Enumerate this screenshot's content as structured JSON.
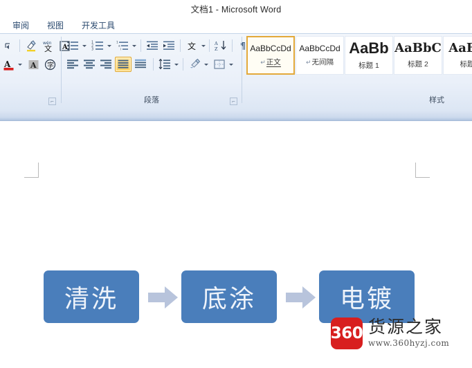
{
  "window": {
    "title": "文档1 - Microsoft Word"
  },
  "ribbon_tabs": [
    {
      "label": "审阅",
      "name": "tab-review"
    },
    {
      "label": "视图",
      "name": "tab-view"
    },
    {
      "label": "开发工具",
      "name": "tab-developer"
    }
  ],
  "ribbon": {
    "font_group": {
      "label": "",
      "buttons_row1": [
        {
          "name": "text-highlight-color-icon",
          "glyph": "✐"
        },
        {
          "name": "phonetic-guide-icon",
          "glyph": "文"
        },
        {
          "name": "character-border-icon",
          "glyph": "A"
        }
      ],
      "buttons_row2": [
        {
          "name": "font-color-icon",
          "glyph": "A"
        },
        {
          "name": "character-shading-icon",
          "glyph": "A"
        },
        {
          "name": "enclose-characters-icon",
          "glyph": "字"
        }
      ]
    },
    "paragraph_group": {
      "label": "段落",
      "buttons_row1": [
        {
          "name": "bullets-icon",
          "glyph": "≔",
          "has_caret": true
        },
        {
          "name": "numbering-icon",
          "glyph": "≕",
          "has_caret": true
        },
        {
          "name": "multilevel-list-icon",
          "glyph": "≣",
          "has_caret": true
        },
        {
          "name": "decrease-indent-icon",
          "glyph": "⇤",
          "has_caret": false
        },
        {
          "name": "increase-indent-icon",
          "glyph": "⇥",
          "has_caret": false
        },
        {
          "name": "asian-layout-icon",
          "glyph": "文",
          "has_caret": true
        },
        {
          "name": "sort-icon",
          "glyph": "A↓",
          "has_caret": false
        },
        {
          "name": "show-formatting-marks-icon",
          "glyph": "¶",
          "has_caret": false
        }
      ],
      "buttons_row2": [
        {
          "name": "align-left-icon",
          "glyph": "",
          "has_caret": false,
          "active": false
        },
        {
          "name": "align-center-icon",
          "glyph": "",
          "has_caret": false,
          "active": false
        },
        {
          "name": "align-right-icon",
          "glyph": "",
          "has_caret": false,
          "active": false
        },
        {
          "name": "justify-icon",
          "glyph": "",
          "has_caret": false,
          "active": true
        },
        {
          "name": "distributed-align-icon",
          "glyph": "",
          "has_caret": false,
          "active": false
        },
        {
          "name": "line-spacing-icon",
          "glyph": "⇕",
          "has_caret": true,
          "active": false
        },
        {
          "name": "shading-icon",
          "glyph": "◴",
          "has_caret": true,
          "active": false
        },
        {
          "name": "borders-icon",
          "glyph": "⊞",
          "has_caret": true,
          "active": false
        }
      ]
    },
    "styles_group": {
      "label": "样式",
      "items": [
        {
          "preview": "AaBbCcDd",
          "name": "正文",
          "pilcrow": "↵",
          "selected": true,
          "preview_size": "12px",
          "preview_weight": "400",
          "preview_serif": false,
          "underline": true
        },
        {
          "preview": "AaBbCcDd",
          "name": "无间隔",
          "pilcrow": "↵",
          "selected": false,
          "preview_size": "12px",
          "preview_weight": "400",
          "preview_serif": false,
          "underline": false
        },
        {
          "preview": "AaBb",
          "name": "标题 1",
          "pilcrow": "",
          "selected": false,
          "preview_size": "22px",
          "preview_weight": "700",
          "preview_serif": false,
          "underline": false
        },
        {
          "preview": "AaBbC",
          "name": "标题 2",
          "pilcrow": "",
          "selected": false,
          "preview_size": "18px",
          "preview_weight": "700",
          "preview_serif": true,
          "underline": false
        },
        {
          "preview": "AaBb",
          "name": "标题",
          "pilcrow": "",
          "selected": false,
          "preview_size": "18px",
          "preview_weight": "700",
          "preview_serif": true,
          "underline": false
        }
      ]
    }
  },
  "document": {
    "smartart": {
      "type": "process",
      "box_fill": "#4a7ebb",
      "box_text_color": "#eef3fa",
      "arrow_fill": "#b8c4dc",
      "steps": [
        {
          "label": "清洗",
          "name": "smartart-step-1"
        },
        {
          "label": "底涂",
          "name": "smartart-step-2"
        },
        {
          "label": "电镀",
          "name": "smartart-step-3"
        }
      ]
    }
  },
  "watermark": {
    "badge": "360",
    "title": "货源之家",
    "url": "www.360hyzj.com",
    "badge_color": "#d81f1f"
  }
}
